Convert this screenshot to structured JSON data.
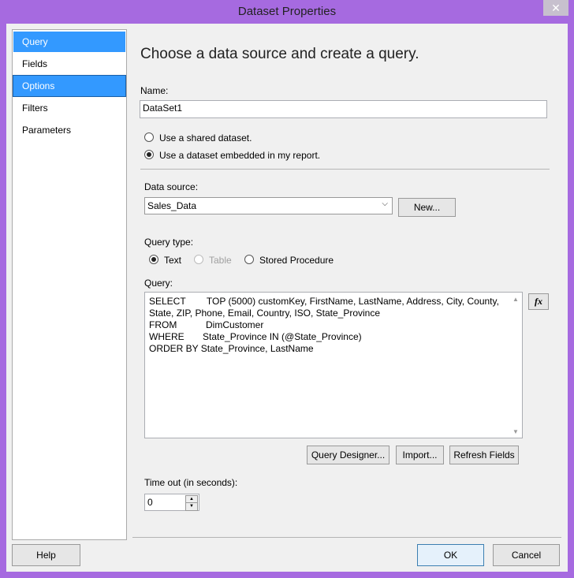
{
  "window": {
    "title": "Dataset Properties",
    "close_glyph": "✕"
  },
  "nav": {
    "items": [
      "Query",
      "Fields",
      "Options",
      "Filters",
      "Parameters"
    ]
  },
  "heading": "Choose a data source and create a query.",
  "name": {
    "label": "Name:",
    "value": "DataSet1"
  },
  "dataset_mode": {
    "shared_label": "Use a shared dataset.",
    "embedded_label": "Use a dataset embedded in my report."
  },
  "data_source": {
    "label": "Data source:",
    "value": "Sales_Data",
    "new_button": "New..."
  },
  "query_type": {
    "label": "Query type:",
    "text": "Text",
    "table": "Table",
    "stored": "Stored Procedure"
  },
  "query": {
    "label": "Query:",
    "text": "SELECT        TOP (5000) customKey, FirstName, LastName, Address, City, County,\nState, ZIP, Phone, Email, Country, ISO, State_Province\nFROM           DimCustomer\nWHERE       State_Province IN (@State_Province)\nORDER BY State_Province, LastName",
    "fx": "fx"
  },
  "query_buttons": {
    "designer": "Query Designer...",
    "import": "Import...",
    "refresh": "Refresh Fields"
  },
  "timeout": {
    "label": "Time out (in seconds):",
    "value": "0"
  },
  "footer": {
    "help": "Help",
    "ok": "OK",
    "cancel": "Cancel"
  },
  "colors": {
    "chrome": "#a66ae0",
    "selection": "#3399ff",
    "dialog_bg": "#f0f0f0"
  }
}
